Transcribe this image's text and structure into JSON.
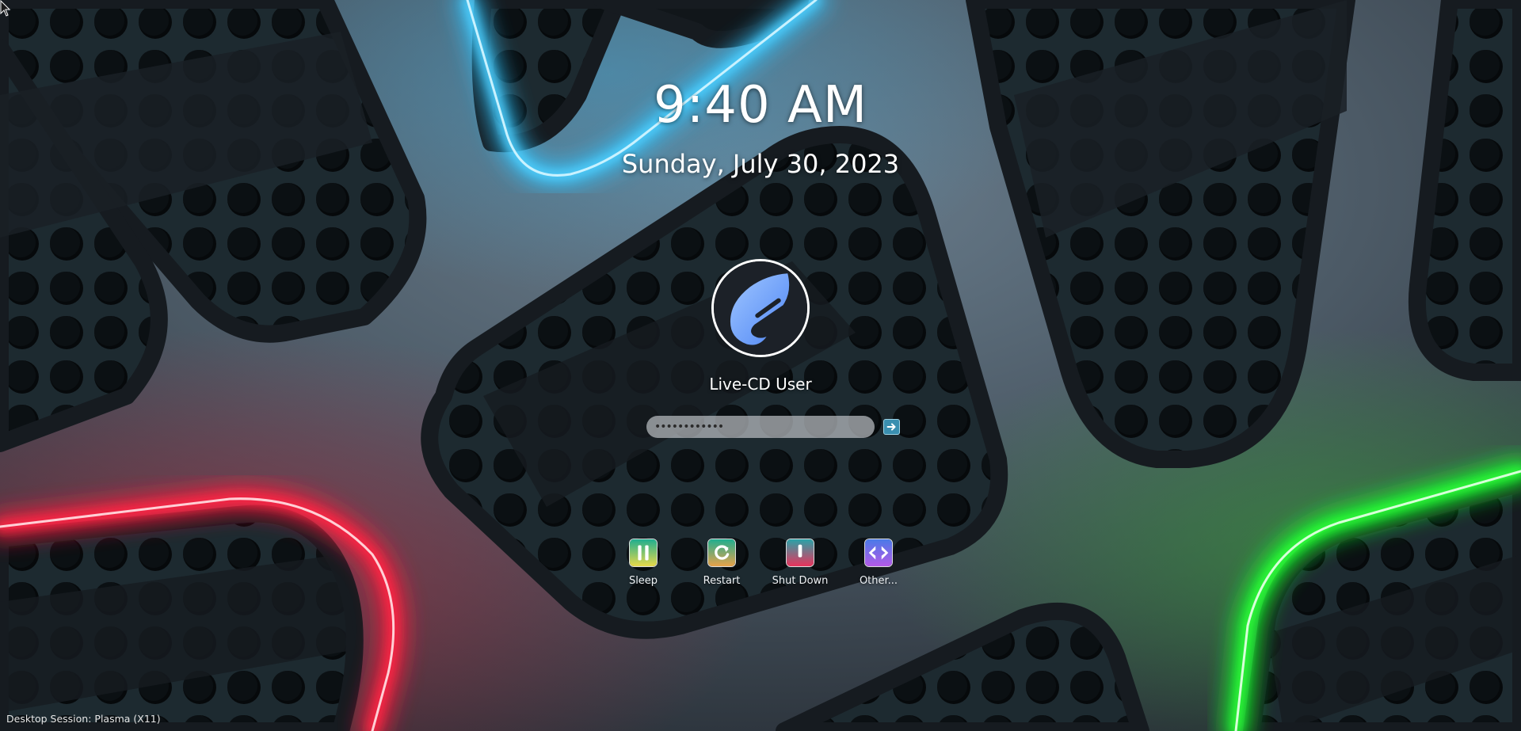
{
  "clock": {
    "time": "9:40 AM",
    "date": "Sunday, July 30, 2023"
  },
  "user": {
    "name": "Live-CD User"
  },
  "password": {
    "value": "••••••••••••"
  },
  "actions": [
    {
      "label": "Sleep",
      "icon": "sleep-icon"
    },
    {
      "label": "Restart",
      "icon": "restart-icon"
    },
    {
      "label": "Shut Down",
      "icon": "shutdown-icon"
    },
    {
      "label": "Other...",
      "icon": "switch-user-icon"
    }
  ],
  "footer": {
    "session": "Desktop Session: Plasma (X11)"
  },
  "colors": {
    "neon_blue": "#2ec5ff",
    "neon_red": "#ff1a3c",
    "neon_green": "#19ff2a",
    "frame_gray": "#4f5b66",
    "mesh_dark": "#14191e"
  }
}
